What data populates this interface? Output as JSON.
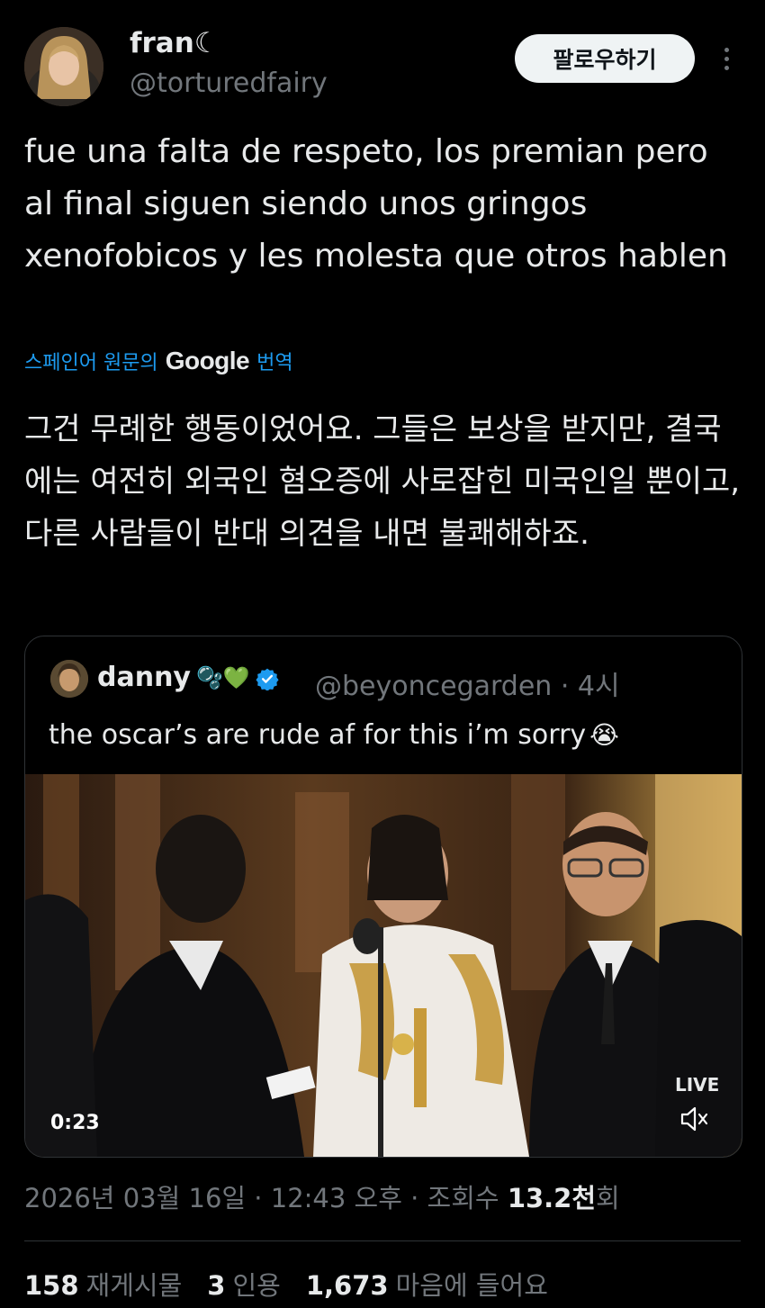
{
  "author": {
    "display_name": "fran☾",
    "handle": "@torturedfairy"
  },
  "follow_button": "팔로우하기",
  "tweet": {
    "text": "fue una falta de respeto, los premian pero al final siguen siendo unos gringos xenofobicos y les molesta que otros hablen",
    "translation_prefix": "스페인어 원문의",
    "translation_brand": "Google",
    "translation_suffix": "번역",
    "translated_text": "그건 무례한 행동이었어요. 그들은 보상을 받지만, 결국에는 여전히 외국인 혐오증에 사로잡힌 미국인일 뿐이고, 다른 사람들이 반대 의견을 내면 불쾌해하죠."
  },
  "quote": {
    "display_name": "danny",
    "name_emojis": "🫧💚",
    "handle_time": "@beyoncegarden · 4시",
    "text": "the oscar’s are rude af for this i’m sorry",
    "text_emoji": "😭",
    "video": {
      "time": "0:23",
      "live_label": "LIVE"
    }
  },
  "meta": {
    "date": "2026년 03월 16일 · 12:43 오후 · 조회수 ",
    "views": "13.2천",
    "views_suffix": "회"
  },
  "stats": {
    "reposts_count": "158",
    "reposts_label": "재게시물",
    "quotes_count": "3",
    "quotes_label": "인용",
    "likes_count": "1,673",
    "likes_label": "마음에 들어요"
  },
  "colors": {
    "background": "#000000",
    "text": "#e7e9ea",
    "muted": "#71767b",
    "link": "#1d9bf0",
    "verified": "#1d9bf0"
  }
}
